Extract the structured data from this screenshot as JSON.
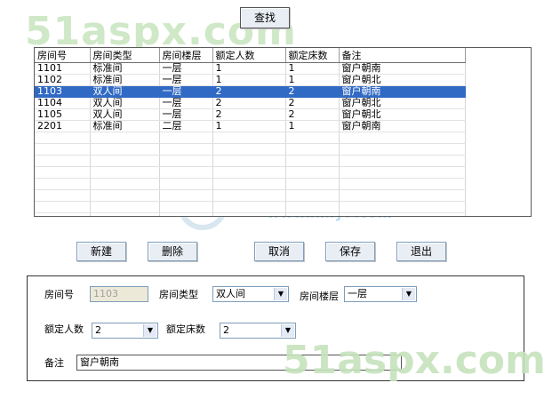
{
  "watermarks": {
    "top": "51aspx.com",
    "middle": "51aspx.com",
    "middle_cn": "小蚂蚁资源网",
    "middle_url": "www.xmy7.com",
    "bottom": "51aspx.com"
  },
  "toolbar": {
    "search_label": "查找"
  },
  "grid": {
    "columns": [
      "房间号",
      "房间类型",
      "房间楼层",
      "额定人数",
      "额定床数",
      "备注"
    ],
    "rows": [
      [
        "1101",
        "标准间",
        "一层",
        "1",
        "1",
        "窗户朝南"
      ],
      [
        "1102",
        "标准间",
        "一层",
        "1",
        "1",
        "窗户朝北"
      ],
      [
        "1103",
        "双人间",
        "一层",
        "2",
        "2",
        "窗户朝南"
      ],
      [
        "1104",
        "双人间",
        "一层",
        "2",
        "2",
        "窗户朝北"
      ],
      [
        "1105",
        "双人间",
        "一层",
        "2",
        "2",
        "窗户朝北"
      ],
      [
        "2201",
        "标准间",
        "二层",
        "1",
        "1",
        "窗户朝南"
      ]
    ],
    "selected_row": 2,
    "empty_rows": 9
  },
  "actions": {
    "new_label": "新建",
    "delete_label": "删除",
    "cancel_label": "取消",
    "save_label": "保存",
    "exit_label": "退出"
  },
  "form": {
    "room_no_label": "房间号",
    "room_no_value": "1103",
    "room_type_label": "房间类型",
    "room_type_value": "双人间",
    "room_floor_label": "房间楼层",
    "room_floor_value": "一层",
    "rated_people_label": "额定人数",
    "rated_people_value": "2",
    "rated_beds_label": "额定床数",
    "rated_beds_value": "2",
    "remark_label": "备注",
    "remark_value": "窗户朝南"
  },
  "colors": {
    "selection": "#316ac5",
    "button_face": "#e9eef5",
    "input_border": "#7f9db9"
  }
}
